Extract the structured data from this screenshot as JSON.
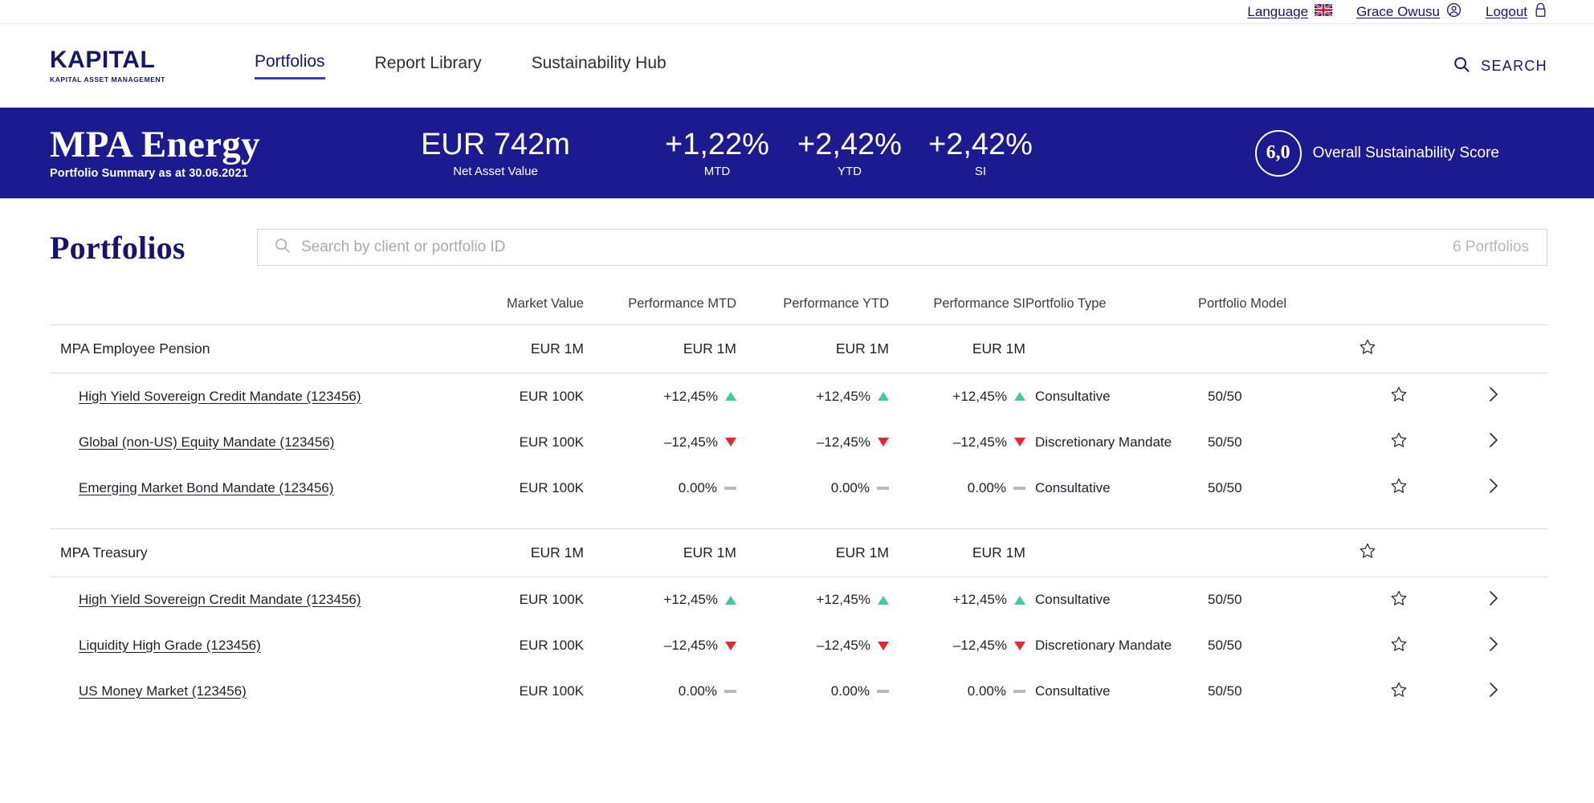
{
  "utility": {
    "language_label": "Language",
    "user_name": "Grace Owusu",
    "logout_label": "Logout"
  },
  "header": {
    "logo_main": "KAPITAL",
    "logo_sub": "KAPITAL ASSET MANAGEMENT",
    "nav": [
      {
        "label": "Portfolios",
        "active": true
      },
      {
        "label": "Report Library",
        "active": false
      },
      {
        "label": "Sustainability Hub",
        "active": false
      }
    ],
    "search_label": "SEARCH"
  },
  "banner": {
    "title": "MPA Energy",
    "subtitle": "Portfolio Summary as at 30.06.2021",
    "metrics": [
      {
        "value": "EUR 742m",
        "label": "Net Asset Value"
      },
      {
        "value": "+1,22%",
        "label": "MTD"
      },
      {
        "value": "+2,42%",
        "label": "YTD"
      },
      {
        "value": "+2,42%",
        "label": "SI"
      }
    ],
    "sustainability_score": "6,0",
    "sustainability_label": "Overall Sustainability Score",
    "background_color": "#1b1a8f"
  },
  "portfolios": {
    "section_title": "Portfolios",
    "search_placeholder": "Search by client or portfolio ID",
    "search_value": "",
    "count_label": "6 Portfolios",
    "columns": {
      "name": "",
      "market_value": "Market Value",
      "performance_mtd": "Performance MTD",
      "performance_ytd": "Performance YTD",
      "performance_si": "Performance SI",
      "portfolio_type": "Portfolio Type",
      "portfolio_model": "Portfolio Model"
    },
    "groups": [
      {
        "name": "MPA Employee Pension",
        "market_value": "EUR 1M",
        "performance_mtd": "EUR 1M",
        "performance_ytd": "EUR 1M",
        "performance_si": "EUR 1M",
        "items": [
          {
            "name": "High Yield Sovereign Credit Mandate (123456)",
            "market_value": "EUR 100K",
            "performance_mtd": "+12,45%",
            "mtd_dir": "up",
            "performance_ytd": "+12,45%",
            "ytd_dir": "up",
            "performance_si": "+12,45%",
            "si_dir": "up",
            "portfolio_type": "Consultative",
            "portfolio_model": "50/50"
          },
          {
            "name": "Global (non-US) Equity Mandate (123456)",
            "market_value": "EUR 100K",
            "performance_mtd": "–12,45%",
            "mtd_dir": "down",
            "performance_ytd": "–12,45%",
            "ytd_dir": "down",
            "performance_si": "–12,45%",
            "si_dir": "down",
            "portfolio_type": "Discretionary Mandate",
            "portfolio_model": "50/50"
          },
          {
            "name": "Emerging Market Bond Mandate (123456)",
            "market_value": "EUR 100K",
            "performance_mtd": "0.00%",
            "mtd_dir": "flat",
            "performance_ytd": "0.00%",
            "ytd_dir": "flat",
            "performance_si": "0.00%",
            "si_dir": "flat",
            "portfolio_type": "Consultative",
            "portfolio_model": "50/50"
          }
        ]
      },
      {
        "name": "MPA Treasury",
        "market_value": "EUR 1M",
        "performance_mtd": "EUR 1M",
        "performance_ytd": "EUR 1M",
        "performance_si": "EUR 1M",
        "items": [
          {
            "name": "High Yield Sovereign Credit Mandate (123456)",
            "market_value": "EUR 100K",
            "performance_mtd": "+12,45%",
            "mtd_dir": "up",
            "performance_ytd": "+12,45%",
            "ytd_dir": "up",
            "performance_si": "+12,45%",
            "si_dir": "up",
            "portfolio_type": "Consultative",
            "portfolio_model": "50/50"
          },
          {
            "name": "Liquidity High Grade (123456)",
            "market_value": "EUR 100K",
            "performance_mtd": "–12,45%",
            "mtd_dir": "down",
            "performance_ytd": "–12,45%",
            "ytd_dir": "down",
            "performance_si": "–12,45%",
            "si_dir": "down",
            "portfolio_type": "Discretionary Mandate",
            "portfolio_model": "50/50"
          },
          {
            "name": "US Money Market (123456)",
            "market_value": "EUR 100K",
            "performance_mtd": "0.00%",
            "mtd_dir": "flat",
            "performance_ytd": "0.00%",
            "ytd_dir": "flat",
            "performance_si": "0.00%",
            "si_dir": "flat",
            "portfolio_type": "Consultative",
            "portfolio_model": "50/50"
          }
        ]
      }
    ]
  },
  "icons": {
    "language_flag": "uk-flag-icon",
    "user": "user-circle-icon",
    "logout": "lock-icon",
    "search": "search-icon",
    "star": "star-outline-icon",
    "chevron": "chevron-right-icon"
  }
}
